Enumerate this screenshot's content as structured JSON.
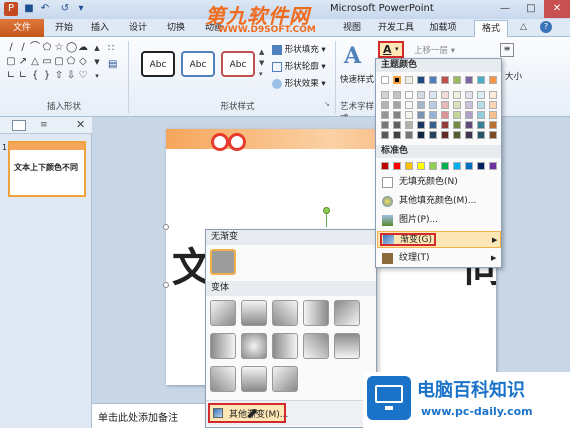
{
  "titlebar": {
    "title": "Microsoft PowerPoint"
  },
  "tabs": {
    "file": "文件",
    "items": [
      "开始",
      "插入",
      "设计",
      "切换",
      "动画",
      "视图",
      "开发工具",
      "加载项",
      "格式"
    ]
  },
  "ribbon": {
    "insert_shapes_label": "插入形状",
    "shape_styles_label": "形状样式",
    "art_styles_label": "艺术字样式",
    "abc": "Abc",
    "shape_fill": "形状填充",
    "shape_outline": "形状轮廓",
    "shape_effects": "形状效果",
    "quick_styles": "快速样式",
    "bring_forward": "上移一层",
    "size_label": "大小"
  },
  "thumbnail": {
    "number": "1",
    "text": "文本上下颜色不同"
  },
  "slide": {
    "partial_left": "文",
    "partial_right": "同"
  },
  "notes": {
    "placeholder": "单击此处添加备注"
  },
  "gallery": {
    "no_gradient": "无渐变",
    "variants": "变体",
    "more_gradients": "其他渐变(M)..."
  },
  "colormenu": {
    "theme_colors": "主题颜色",
    "standard_colors": "标准色",
    "no_fill": "无填充颜色(N)",
    "more_colors": "其他填充颜色(M)...",
    "picture": "图片(P)...",
    "gradient": "渐变(G)",
    "texture": "纹理(T)",
    "theme_row": [
      "#ffffff",
      "#000000",
      "#eeece1",
      "#1f497d",
      "#4f81bd",
      "#c0504d",
      "#9bbb59",
      "#8064a2",
      "#4bacc6",
      "#f79646"
    ],
    "standard_row": [
      "#c00000",
      "#ff0000",
      "#ffc000",
      "#ffff00",
      "#92d050",
      "#00b050",
      "#00b0f0",
      "#0070c0",
      "#002060",
      "#7030a0"
    ]
  },
  "watermark": {
    "top": "第九软件网",
    "url": "WWW.D9SOFT.COM",
    "brand": "电脑百科知识",
    "brand_url": "www.pc-daily.com"
  },
  "colors": {
    "accent": "#e0773b",
    "highlight": "#d12b2b",
    "ribbon_blue": "#a9bfd6"
  }
}
